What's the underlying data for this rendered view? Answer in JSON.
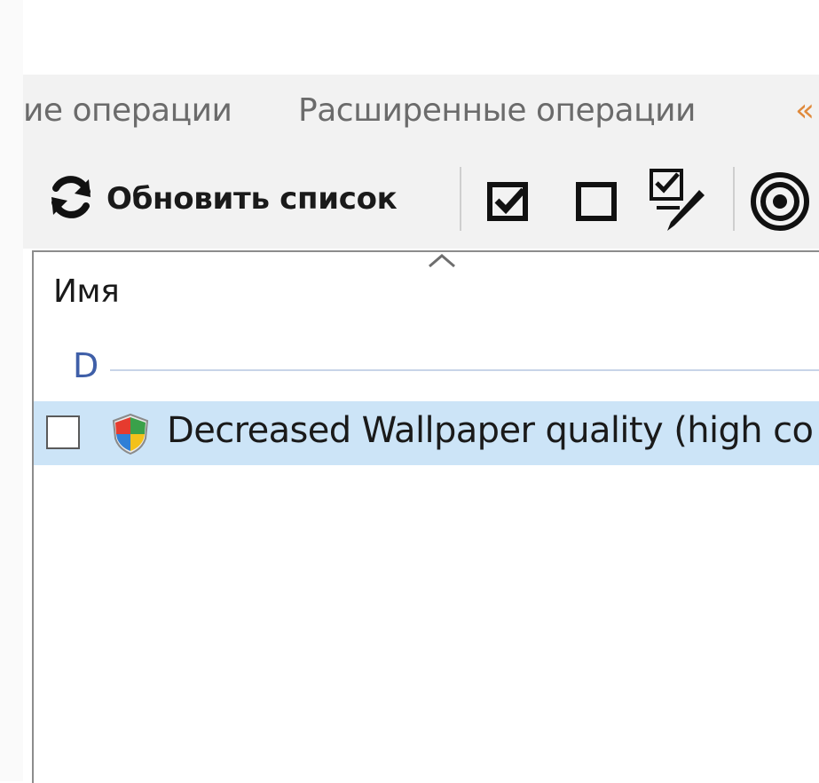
{
  "tabs": [
    {
      "label": "ие операции"
    },
    {
      "label": "Расширенные операции"
    },
    {
      "label": "«"
    }
  ],
  "toolbar": {
    "refresh_label": "Обновить список",
    "icons": [
      "refresh-icon",
      "check-all-icon",
      "uncheck-all-icon",
      "edit-checks-icon",
      "target-icon"
    ]
  },
  "list": {
    "column_header": "Имя",
    "group_letter": "D",
    "items": [
      {
        "label": "Decreased Wallpaper quality (high co",
        "checked": false,
        "selected": true,
        "icon": "shield-icon"
      }
    ]
  },
  "colors": {
    "selection": "#cce4f7",
    "group_text": "#3f5fa8",
    "toolbar_bg": "#f2f2f2"
  }
}
